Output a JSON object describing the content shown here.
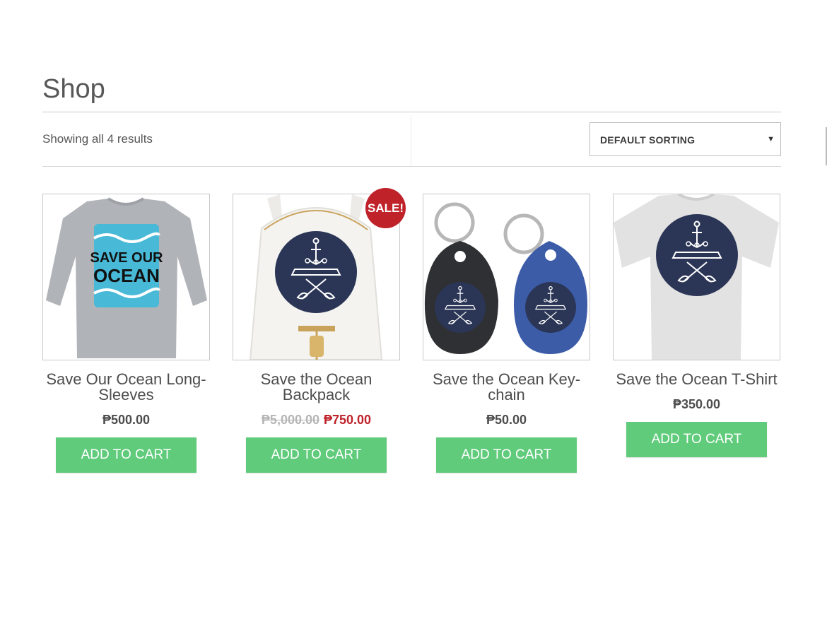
{
  "page": {
    "title": "Shop"
  },
  "toolbar": {
    "result_count": "Showing all 4 results",
    "sort_selected": "DEFAULT SORTING"
  },
  "products": [
    {
      "title": "Save Our Ocean Long-Sleeves",
      "price": "₱500.00",
      "button": "ADD TO CART",
      "image_text": [
        "SAVE OUR",
        "OCEAN"
      ]
    },
    {
      "title": "Save the Ocean Backpack",
      "old_price": "₱5,000.00",
      "price": "₱750.00",
      "badge": "SALE!",
      "button": "ADD TO CART"
    },
    {
      "title": "Save the Ocean Key-chain",
      "price": "₱50.00",
      "button": "ADD TO CART"
    },
    {
      "title": "Save the Ocean T-Shirt",
      "price": "₱350.00",
      "button": "ADD TO CART"
    }
  ],
  "colors": {
    "button": "#5fcb7b",
    "sale": "#c0222a",
    "emblem": "#2b3556"
  }
}
